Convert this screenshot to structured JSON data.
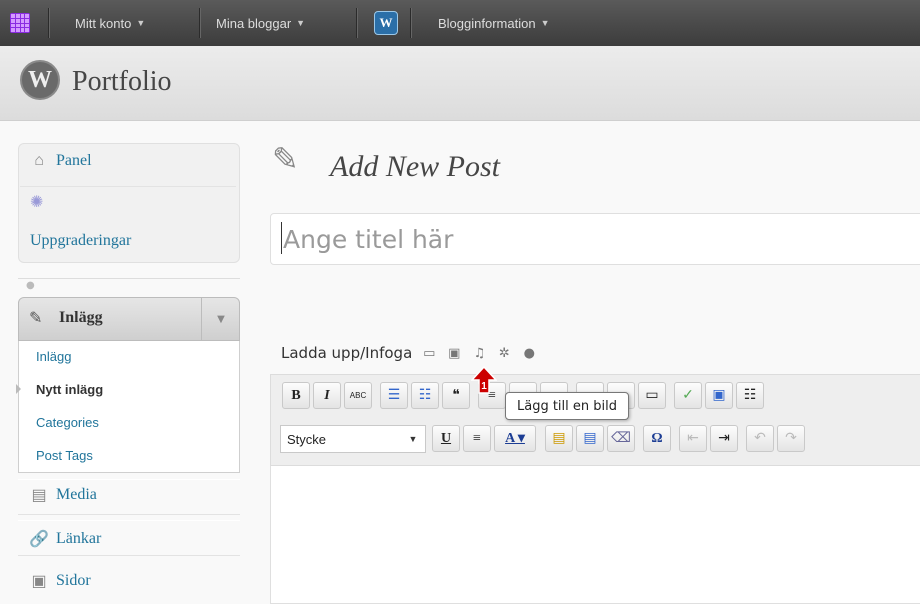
{
  "adminbar": {
    "my_account": "Mitt konto",
    "my_blogs": "Mina bloggar",
    "blog_info": "Blogginformation"
  },
  "header": {
    "site_title": "Portfolio"
  },
  "sidebar": {
    "panel": "Panel",
    "upgrades": "Uppgraderingar",
    "posts_heading": "Inlägg",
    "posts_sub": [
      "Inlägg",
      "Nytt inlägg",
      "Categories",
      "Post Tags"
    ],
    "media": "Media",
    "links": "Länkar",
    "pages": "Sidor"
  },
  "main": {
    "page_title": "Add New Post",
    "title_placeholder": "Ange titel här",
    "upload_label": "Ladda upp/Infoga",
    "format_select": "Stycke",
    "tooltip": "Lägg till en bild"
  },
  "icons": {
    "panel": "home-icon",
    "upgrades": "gear-icon",
    "posts": "pushpin-icon",
    "media": "media-icon",
    "links": "link-icon",
    "pages": "pages-icon"
  },
  "colors": {
    "link": "#21759b",
    "adminbar": "#464646",
    "marker": "#cc0000"
  }
}
